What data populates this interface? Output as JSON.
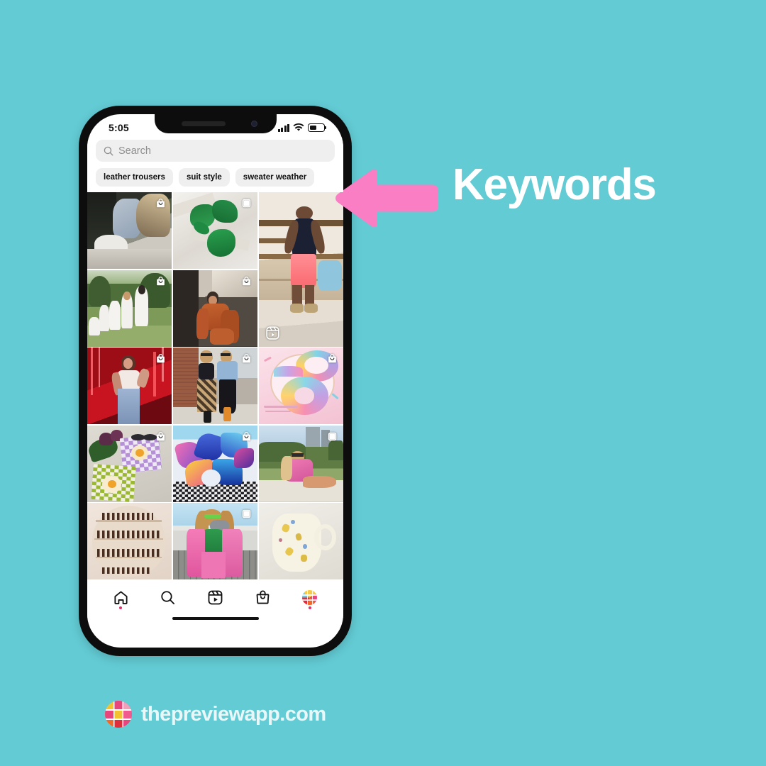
{
  "background_color": "#63cbd4",
  "annotation": {
    "label": "Keywords",
    "label_color": "#ffffff",
    "arrow_color": "#f97ec4",
    "arrow_icon": "arrow-left-icon",
    "arrow_direction": "left"
  },
  "footer": {
    "brand_text": "thepreviewapp.com",
    "logo_icon": "preview-app-logo-icon",
    "text_color": "#eaf7f8"
  },
  "phone": {
    "status_bar": {
      "time": "5:05",
      "signal_icon": "cellular-signal-icon",
      "wifi_icon": "wifi-icon",
      "battery_icon": "battery-half-icon",
      "battery_level_pct": 52
    },
    "search": {
      "placeholder": "Search",
      "value": "",
      "icon": "search-icon"
    },
    "keyword_pills": [
      {
        "label": "leather trousers"
      },
      {
        "label": "suit style"
      },
      {
        "label": "sweater weather"
      }
    ],
    "grid": {
      "columns": 3,
      "posts": [
        {
          "id": "p1",
          "alt": "woman in jeans and white sneakers sitting in car",
          "badge": "shopping-bag-icon",
          "span": 1
        },
        {
          "id": "p2",
          "alt": "green lace lingerie set on white crumpled bedsheet",
          "badge": "carousel-icon",
          "span": 1
        },
        {
          "id": "p3",
          "alt": "man in black tank top and pink shorts in closet",
          "badge": "reel-icon",
          "span": 2
        },
        {
          "id": "p4",
          "alt": "family of girls in white dresses in green field",
          "badge": "shopping-bag-icon",
          "span": 1
        },
        {
          "id": "p5",
          "alt": "woman in rust orange lounge set on sofa",
          "badge": "shopping-bag-icon",
          "span": 1
        },
        {
          "id": "p6",
          "alt": "woman in white top and jeans with red neon lights",
          "badge": "shopping-bag-icon",
          "span": 1
        },
        {
          "id": "p7",
          "alt": "two women in denim jackets on brick street",
          "badge": "shopping-bag-icon",
          "span": 1
        },
        {
          "id": "p8",
          "alt": "pastel rainbow donuts with sprinkles on pink plate",
          "badge": "shopping-bag-icon",
          "span": 1
        },
        {
          "id": "p9",
          "alt": "crochet checkered flower bags with tulips",
          "badge": "shopping-bag-icon",
          "span": 1
        },
        {
          "id": "p10",
          "alt": "pile of colourful patterned swimwear",
          "badge": "shopping-bag-icon",
          "span": 1
        },
        {
          "id": "p11",
          "alt": "woman in pink dress sitting on grass in park",
          "badge": "carousel-icon",
          "span": 1
        },
        {
          "id": "p12",
          "alt": "shelf display of amber apothecary bottles",
          "badge": "none",
          "span": 1
        },
        {
          "id": "p13",
          "alt": "woman in pink coat and green scarf holding mug",
          "badge": "carousel-icon",
          "span": 1
        },
        {
          "id": "p14",
          "alt": "cream ceramic jug with painted bees and flowers",
          "badge": "none",
          "span": 1
        }
      ]
    },
    "bottom_nav": [
      {
        "name": "home",
        "icon": "home-icon",
        "active": true,
        "has_dot": true
      },
      {
        "name": "search",
        "icon": "search-icon",
        "active": false,
        "has_dot": false
      },
      {
        "name": "reels",
        "icon": "reels-icon",
        "active": false,
        "has_dot": false
      },
      {
        "name": "shop",
        "icon": "shopping-bag-icon",
        "active": false,
        "has_dot": false
      },
      {
        "name": "profile",
        "icon": "profile-avatar-icon",
        "active": false,
        "has_dot": true
      }
    ]
  }
}
